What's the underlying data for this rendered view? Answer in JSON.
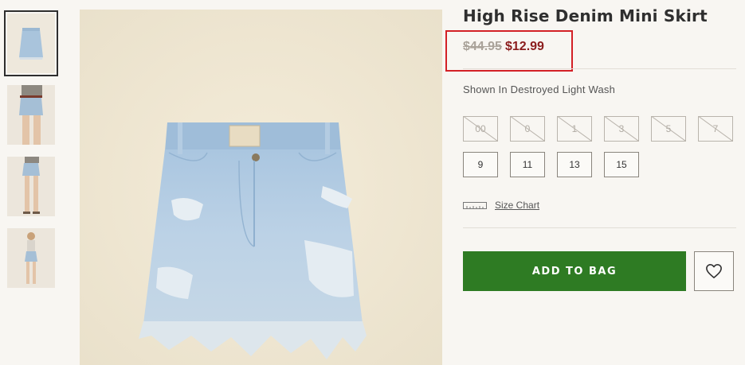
{
  "product": {
    "title": "High Rise Denim Mini Skirt",
    "price_original": "$44.95",
    "price_sale": "$12.99",
    "shown_in": "Shown In Destroyed Light Wash",
    "sale_color": "#8b1d1d",
    "highlight_color": "#d32026"
  },
  "gallery": {
    "thumbnails": [
      {
        "name": "skirt-flat",
        "active": true
      },
      {
        "name": "model-front-closeup",
        "active": false
      },
      {
        "name": "model-back",
        "active": false
      },
      {
        "name": "model-full",
        "active": false
      }
    ],
    "main_image": "skirt-flat-lay"
  },
  "sizes": [
    {
      "label": "00",
      "available": false
    },
    {
      "label": "0",
      "available": false
    },
    {
      "label": "1",
      "available": false
    },
    {
      "label": "3",
      "available": false
    },
    {
      "label": "5",
      "available": false
    },
    {
      "label": "7",
      "available": false
    },
    {
      "label": "9",
      "available": true
    },
    {
      "label": "11",
      "available": true
    },
    {
      "label": "13",
      "available": true
    },
    {
      "label": "15",
      "available": true
    }
  ],
  "size_chart": {
    "label": "Size Chart",
    "icon": "ruler-icon"
  },
  "actions": {
    "add_to_bag": "ADD TO BAG",
    "add_to_bag_color": "#2e7b23",
    "favorite_icon": "heart-icon"
  }
}
